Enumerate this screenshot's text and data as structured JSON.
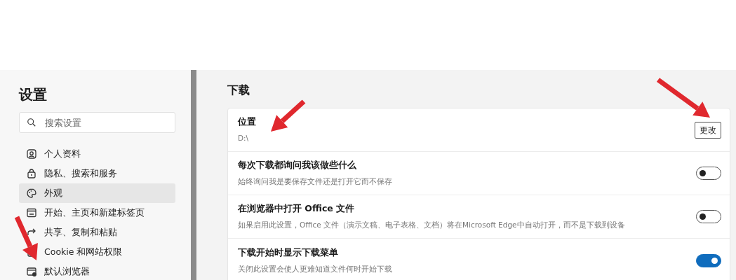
{
  "sidebar": {
    "title": "设置",
    "search": {
      "placeholder": "搜索设置"
    },
    "items": [
      {
        "label": "个人资料",
        "selected": false
      },
      {
        "label": "隐私、搜索和服务",
        "selected": false
      },
      {
        "label": "外观",
        "selected": true
      },
      {
        "label": "开始、主页和新建标签页",
        "selected": false
      },
      {
        "label": "共享、复制和粘贴",
        "selected": false
      },
      {
        "label": "Cookie 和网站权限",
        "selected": false
      },
      {
        "label": "默认浏览器",
        "selected": false
      }
    ]
  },
  "section": {
    "title": "下载",
    "rows": [
      {
        "kind": "button",
        "title": "位置",
        "detail": "D:\\",
        "button": "更改"
      },
      {
        "kind": "toggle",
        "title": "每次下载都询问我该做些什么",
        "detail": "始终询问我是要保存文件还是打开它而不保存",
        "on": false
      },
      {
        "kind": "toggle",
        "title": "在浏览器中打开 Office 文件",
        "detail": "如果启用此设置，Office 文件（演示文稿、电子表格、文档）将在Microsoft Edge中自动打开，而不是下载到设备",
        "on": false
      },
      {
        "kind": "toggle",
        "title": "下载开始时显示下载菜单",
        "detail": "关闭此设置会使人更难知道文件何时开始下载",
        "on": true
      }
    ]
  }
}
